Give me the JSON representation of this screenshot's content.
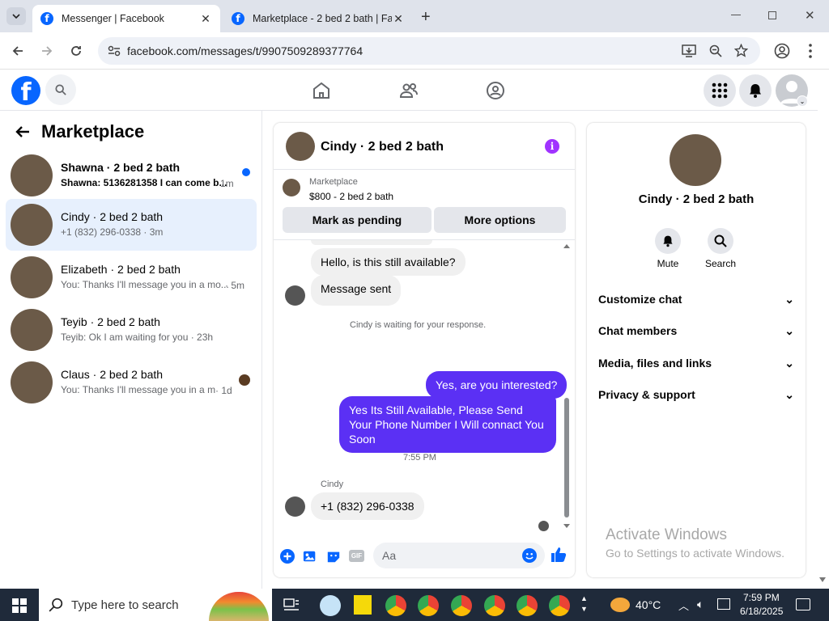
{
  "browser": {
    "tabs": [
      {
        "title": "Messenger | Facebook"
      },
      {
        "title": "Marketplace - 2 bed 2 bath | Fa"
      }
    ],
    "url": "facebook.com/messages/t/9907509289377764"
  },
  "left": {
    "title": "Marketplace",
    "conversations": [
      {
        "name": "Shawna · 2 bed 2 bath",
        "preview": "Shawna: 5136281358 I can come b...",
        "time": "1m",
        "unread": true
      },
      {
        "name": "Cindy · 2 bed 2 bath",
        "preview": "+1 (832) 296-0338 · 3m",
        "time": "",
        "selected": true
      },
      {
        "name": "Elizabeth · 2 bed 2 bath",
        "preview": "You: Thanks I'll message you in a mo...",
        "time": "· 5m"
      },
      {
        "name": "Teyib · 2 bed 2 bath",
        "preview": "Teyib: Ok I am waiting for you · 23h",
        "time": ""
      },
      {
        "name": "Claus · 2 bed 2 bath",
        "preview": "You: Thanks I'll message you in a m...",
        "time": "· 1d"
      }
    ]
  },
  "chat": {
    "title": "Cindy · 2 bed 2 bath",
    "listing_source": "Marketplace",
    "listing_price": "$800 - 2 bed 2 bath",
    "btn_pending": "Mark as pending",
    "btn_more": "More options",
    "messages": {
      "m1": "Hello, is this still available?",
      "m2": "Message sent",
      "sys": "Cindy is waiting for your response.",
      "m3": "Yes, are you interested?",
      "m4": "Yes Its Still Available, Please Send Your Phone Number I Will connact You Soon",
      "time": "7:55 PM",
      "sender": "Cindy",
      "m5": "+1 (832) 296-0338"
    },
    "composer_placeholder": "Aa"
  },
  "right": {
    "name": "Cindy · 2 bed 2 bath",
    "mute": "Mute",
    "search": "Search",
    "sections": [
      "Customize chat",
      "Chat members",
      "Media, files and links",
      "Privacy & support"
    ],
    "watermark_title": "Activate Windows",
    "watermark_sub": "Go to Settings to activate Windows."
  },
  "taskbar": {
    "search_placeholder": "Type here to search",
    "temp": "40°C",
    "time": "7:59 PM",
    "date": "6/18/2025"
  },
  "colors": {
    "fb_blue": "#0866ff",
    "messenger_purple": "#5b30f4",
    "selected_bg": "#e7f0fd"
  }
}
